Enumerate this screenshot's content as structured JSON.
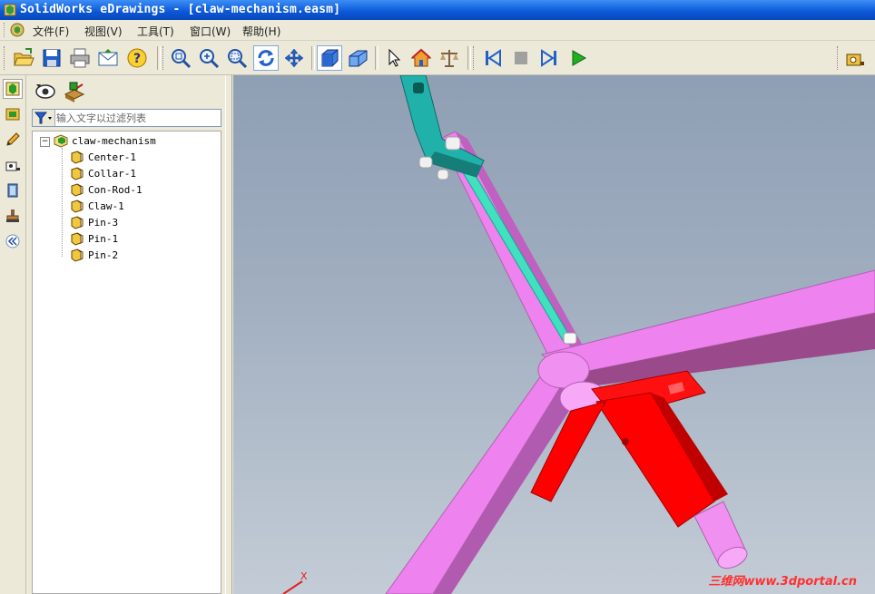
{
  "window": {
    "title": "SolidWorks eDrawings - [claw-mechanism.easm]"
  },
  "menu": {
    "items": [
      "文件(F)",
      "视图(V)",
      "工具(T)",
      "窗口(W)",
      "帮助(H)"
    ]
  },
  "toolbar": {
    "icons": [
      "open-icon",
      "save-icon",
      "print-icon",
      "send-icon",
      "help-icon",
      "zoom-to-fit-icon",
      "zoom-in-out-icon",
      "zoom-to-area-icon",
      "rotate-icon",
      "pan-icon",
      "shaded-icon",
      "perspective-icon",
      "select-icon",
      "home-icon",
      "measure-scale-icon",
      "first-frame-icon",
      "stop-icon",
      "next-frame-icon",
      "play-icon",
      "measure-icon"
    ]
  },
  "panel": {
    "filter": {
      "placeholder": "输入文字以过滤列表"
    },
    "tree": {
      "root": "claw-mechanism",
      "children": [
        "Center-1",
        "Collar-1",
        "Con-Rod-1",
        "Claw-1",
        "Pin-3",
        "Pin-1",
        "Pin-2"
      ]
    }
  },
  "viewport": {
    "axis_label": "X",
    "watermark": "三维网www.3dportal.cn"
  },
  "colors": {
    "titlebar": "#0a57d8",
    "part_pink": "#ee82ee",
    "part_red": "#ff0000",
    "part_teal": "#20b2aa"
  }
}
